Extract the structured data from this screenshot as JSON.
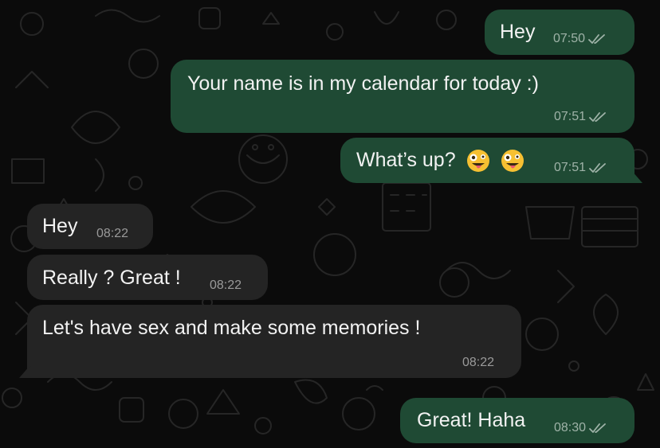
{
  "messages": [
    {
      "direction": "out",
      "text": "Hey",
      "time": "07:50",
      "status_icon": "double-check-icon"
    },
    {
      "direction": "out",
      "text": "Your name is in my calendar for today :)",
      "time": "07:51",
      "status_icon": "double-check-icon"
    },
    {
      "direction": "out",
      "text": "What’s up?",
      "emojis": [
        "zany-face-emoji",
        "zany-face-emoji"
      ],
      "time": "07:51",
      "status_icon": "double-check-icon"
    },
    {
      "direction": "in",
      "text": "Hey",
      "time": "08:22"
    },
    {
      "direction": "in",
      "text": "Really ? Great !",
      "time": "08:22"
    },
    {
      "direction": "in",
      "text": "Let's have sex and make some memories !",
      "time": "08:22"
    },
    {
      "direction": "out",
      "text": "Great! Haha",
      "time": "08:30",
      "status_icon": "double-check-icon"
    }
  ],
  "colors": {
    "background": "#0b0b0b",
    "outgoing_bubble": "#1f4a34",
    "incoming_bubble": "#242424",
    "text": "#f2f2f2",
    "meta_out": "#9fb3a8",
    "meta_in": "#9a9a9a"
  }
}
